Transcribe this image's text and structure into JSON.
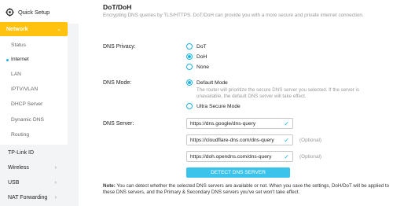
{
  "sidebar": {
    "quick_setup": "Quick Setup",
    "network": "Network",
    "network_sub": [
      "Status",
      "Internet",
      "LAN",
      "IPTV/VLAN",
      "DHCP Server",
      "Dynamic DNS",
      "Routing"
    ],
    "main_items": [
      "TP-Link ID",
      "Wireless",
      "USB",
      "NAT Forwarding"
    ]
  },
  "content": {
    "title": "DoT/DoH",
    "description": "Encrypting DNS queries by TLS/HTTPS. DoT/DoH can provide you with a more secure and private internet connection.",
    "dns_privacy_label": "DNS Privacy:",
    "privacy_options": [
      "DoT",
      "DoH",
      "None"
    ],
    "privacy_selected": "DoH",
    "dns_mode_label": "DNS Mode:",
    "mode_options": [
      "Default Mode",
      "Ultra Secure Mode"
    ],
    "mode_selected": "Default Mode",
    "mode_description": "The router will prioritize the secure DNS server you selected. If the server is unavailable, the default DNS server will take effect.",
    "dns_server_label": "DNS Server:",
    "servers": [
      "https://dns.google/dns-query",
      "https://cloudflare-dns.com/dns-query",
      "https://doh.opendns.com/dns-query"
    ],
    "optional": "(Optional)",
    "detect_button": "DETECT DNS SERVER",
    "note_label": "Note:",
    "note_text": " You can detect whether the selected DNS servers are available or not. When you save the settings, DoH/DoT will be applied to these DNS servers, and the Primary & Secondary DNS servers you've set won't take effect."
  },
  "colors": {
    "accent": "#ffc20e",
    "blue": "#1ab3e6",
    "button": "#3cc3ec"
  }
}
